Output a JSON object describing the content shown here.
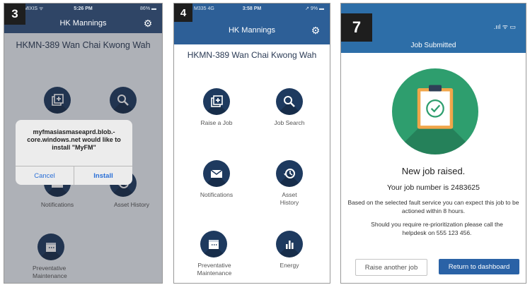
{
  "panel3": {
    "badge": "3",
    "status": {
      "carrier": "MIXIS ᯤ",
      "time": "5:26 PM",
      "battery": "86% ▬"
    },
    "nav_title": "HK Mannings",
    "site_title": "HKMN-389 Wan Chai Kwong Wah",
    "tiles": [
      {
        "label": ""
      },
      {
        "label": ""
      },
      {
        "label": "Notifications"
      },
      {
        "label": "Asset History"
      },
      {
        "label": "Preventative Maintenance"
      }
    ],
    "dialog": {
      "message": "myfmasiasmaseaprd.blob.-core.windows.net would like to install \"MyFM\"",
      "cancel": "Cancel",
      "install": "Install"
    }
  },
  "panel4": {
    "badge": "4",
    "status": {
      "carrier": "M335 4G",
      "time": "3:58 PM",
      "battery": "↗ 9% ▬"
    },
    "nav_title": "HK Mannings",
    "site_title": "HKMN-389 Wan Chai Kwong Wah",
    "tiles": [
      {
        "label": "Raise a Job",
        "icon": "add-icon"
      },
      {
        "label": "Job Search",
        "icon": "search-icon"
      },
      {
        "label": "Notifications",
        "icon": "mail-icon"
      },
      {
        "label": "Asset History",
        "icon": "history-icon"
      },
      {
        "label": "Preventative Maintenance",
        "icon": "calendar-icon"
      },
      {
        "label": "Energy",
        "icon": "bar-chart-icon"
      }
    ]
  },
  "panel7": {
    "badge": "7",
    "status_icons": ".ııl ᯤ ▭",
    "header_title": "Job Submitted",
    "heading": "New job raised.",
    "job_line": "Your job number is 2483625",
    "para1": "Based on the selected fault service you can expect this job to be actioned within 8 hours.",
    "para2": "Should you require re-prioritization please call the helpdesk on 555 123 456.",
    "raise_another": "Raise another job",
    "return_dashboard": "Return to dashboard"
  },
  "colors": {
    "navy": "#1e3a5f",
    "header_blue": "#2d6ea8",
    "green": "#2e9e6e",
    "button_blue": "#2a62a6"
  }
}
